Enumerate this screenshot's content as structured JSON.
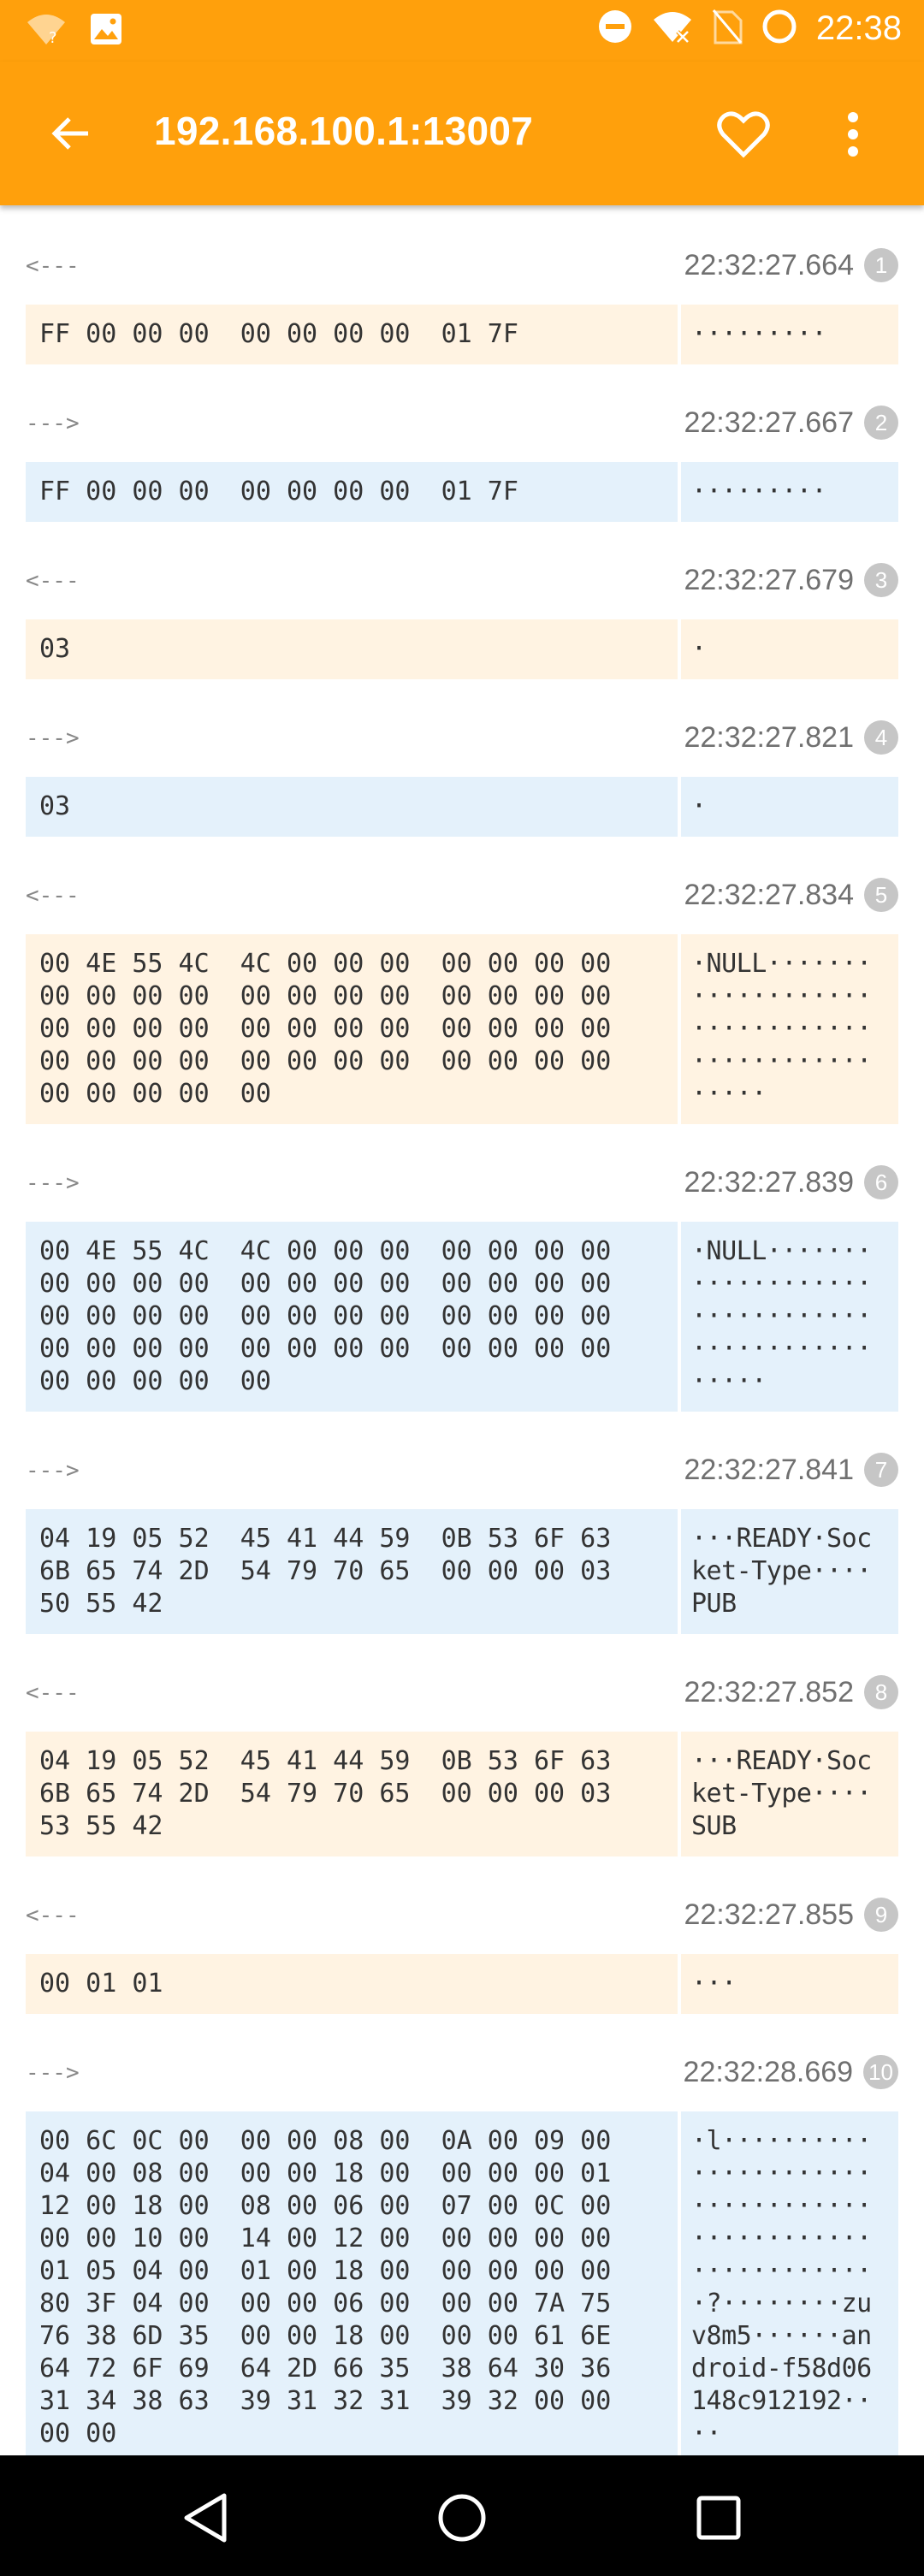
{
  "status": {
    "time": "22:38",
    "icons": [
      "wifi-question-icon",
      "image-icon",
      "do-not-disturb-icon",
      "wifi-x-icon",
      "no-sim-icon",
      "battery-ring-icon"
    ]
  },
  "appbar": {
    "title": "192.168.100.1:13007",
    "back_icon": "arrow-left-icon",
    "fav_icon": "heart-outline-icon",
    "menu_icon": "more-vert-icon"
  },
  "colors": {
    "accent": "#ffa00c",
    "incoming_bg": "#fff3e2",
    "outgoing_bg": "#e4f1fb",
    "index_badge": "#c6c6c6"
  },
  "messages": [
    {
      "dir": "<---",
      "kind": "in",
      "time": "22:32:27.664",
      "index": "1",
      "hex": "FF 00 00 00  00 00 00 00  01 7F",
      "ascii": "·········"
    },
    {
      "dir": "--->",
      "kind": "out",
      "time": "22:32:27.667",
      "index": "2",
      "hex": "FF 00 00 00  00 00 00 00  01 7F",
      "ascii": "·········"
    },
    {
      "dir": "<---",
      "kind": "in",
      "time": "22:32:27.679",
      "index": "3",
      "hex": "03",
      "ascii": "·"
    },
    {
      "dir": "--->",
      "kind": "out",
      "time": "22:32:27.821",
      "index": "4",
      "hex": "03",
      "ascii": "·"
    },
    {
      "dir": "<---",
      "kind": "in",
      "time": "22:32:27.834",
      "index": "5",
      "hex": "00 4E 55 4C  4C 00 00 00  00 00 00 00\n00 00 00 00  00 00 00 00  00 00 00 00\n00 00 00 00  00 00 00 00  00 00 00 00\n00 00 00 00  00 00 00 00  00 00 00 00\n00 00 00 00  00",
      "ascii": "·NULL·······\n············\n············\n············\n·····"
    },
    {
      "dir": "--->",
      "kind": "out",
      "time": "22:32:27.839",
      "index": "6",
      "hex": "00 4E 55 4C  4C 00 00 00  00 00 00 00\n00 00 00 00  00 00 00 00  00 00 00 00\n00 00 00 00  00 00 00 00  00 00 00 00\n00 00 00 00  00 00 00 00  00 00 00 00\n00 00 00 00  00",
      "ascii": "·NULL·······\n············\n············\n············\n·····"
    },
    {
      "dir": "--->",
      "kind": "out",
      "time": "22:32:27.841",
      "index": "7",
      "hex": "04 19 05 52  45 41 44 59  0B 53 6F 63\n6B 65 74 2D  54 79 70 65  00 00 00 03\n50 55 42",
      "ascii": "···READY·Soc\nket-Type····\nPUB"
    },
    {
      "dir": "<---",
      "kind": "in",
      "time": "22:32:27.852",
      "index": "8",
      "hex": "04 19 05 52  45 41 44 59  0B 53 6F 63\n6B 65 74 2D  54 79 70 65  00 00 00 03\n53 55 42",
      "ascii": "···READY·Soc\nket-Type····\nSUB"
    },
    {
      "dir": "<---",
      "kind": "in",
      "time": "22:32:27.855",
      "index": "9",
      "hex": "00 01 01",
      "ascii": "···"
    },
    {
      "dir": "--->",
      "kind": "out",
      "time": "22:32:28.669",
      "index": "10",
      "hex": "00 6C 0C 00  00 00 08 00  0A 00 09 00\n04 00 08 00  00 00 18 00  00 00 00 01\n12 00 18 00  08 00 06 00  07 00 0C 00\n00 00 10 00  14 00 12 00  00 00 00 00\n01 05 04 00  01 00 18 00  00 00 00 00\n80 3F 04 00  00 00 06 00  00 00 7A 75\n76 38 6D 35  00 00 18 00  00 00 61 6E\n64 72 6F 69  64 2D 66 35  38 64 30 36\n31 34 38 63  39 31 32 31  39 32 00 00\n00 00",
      "ascii": "·l··········\n············\n············\n············\n············\n·?········zu\nv8m5······an\ndroid-f58d06\n148c912192··\n··"
    }
  ],
  "navbar": {
    "back_icon": "nav-back-triangle-icon",
    "home_icon": "nav-home-circle-icon",
    "recents_icon": "nav-recents-square-icon"
  }
}
